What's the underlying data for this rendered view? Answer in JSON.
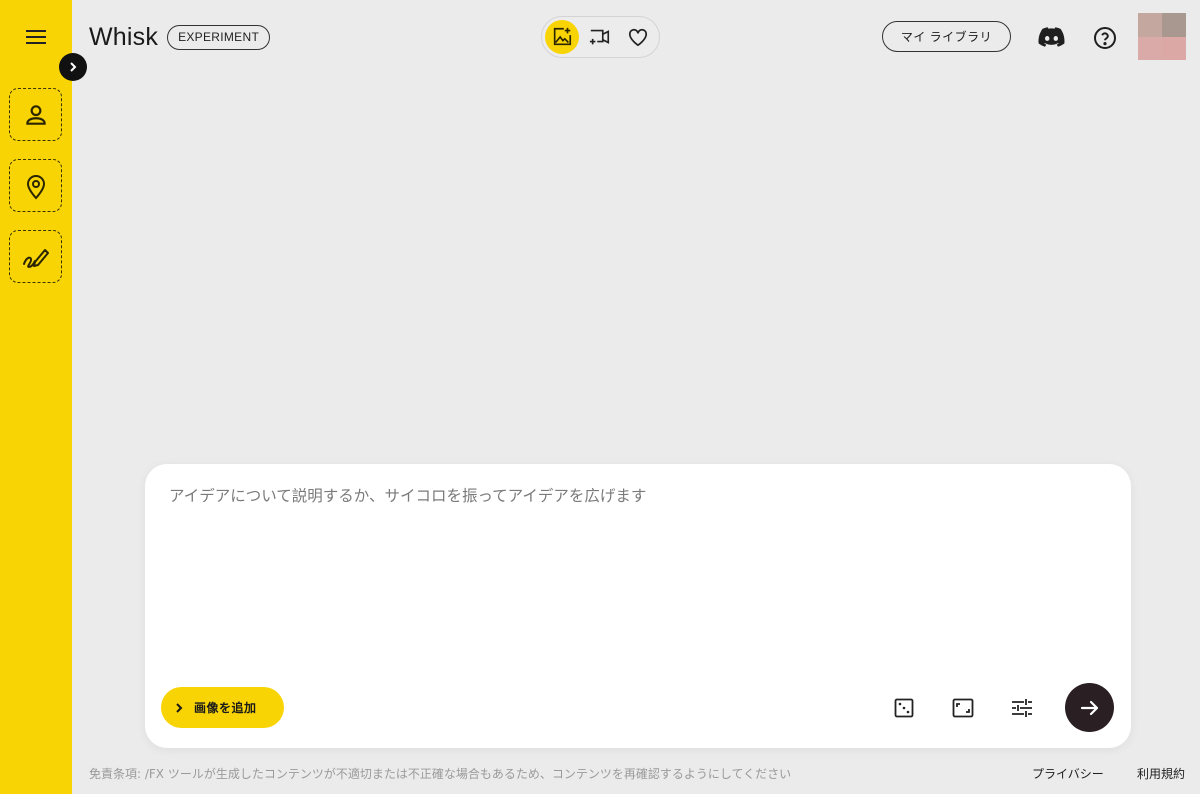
{
  "app": {
    "title": "Whisk",
    "badge": "EXPERIMENT",
    "accent_color": "#f8d404"
  },
  "sidebar": {
    "menu_icon": "menu-icon",
    "expand_icon": "chevron-right-icon",
    "slots": [
      {
        "icon": "person-icon"
      },
      {
        "icon": "location-pin-icon"
      },
      {
        "icon": "style-brush-icon"
      }
    ]
  },
  "header": {
    "modes": [
      {
        "icon": "image-sparkle-icon",
        "selected": true
      },
      {
        "icon": "video-sparkle-icon",
        "selected": false
      },
      {
        "icon": "heart-icon",
        "selected": false
      }
    ],
    "library_label": "マイ ライブラリ",
    "discord_icon": "discord-icon",
    "help_icon": "help-icon"
  },
  "prompt": {
    "placeholder": "アイデアについて説明するか、サイコロを振ってアイデアを広げます",
    "value": "",
    "add_image_label": "画像を追加",
    "tools": [
      "dice-icon",
      "aspect-ratio-icon",
      "tune-icon"
    ],
    "submit_icon": "arrow-right-icon"
  },
  "footer": {
    "disclaimer": "免責条項: /FX ツールが生成したコンテンツが不適切または不正確な場合もあるため、コンテンツを再確認するようにしてください",
    "privacy": "プライバシー",
    "terms": "利用規約"
  }
}
